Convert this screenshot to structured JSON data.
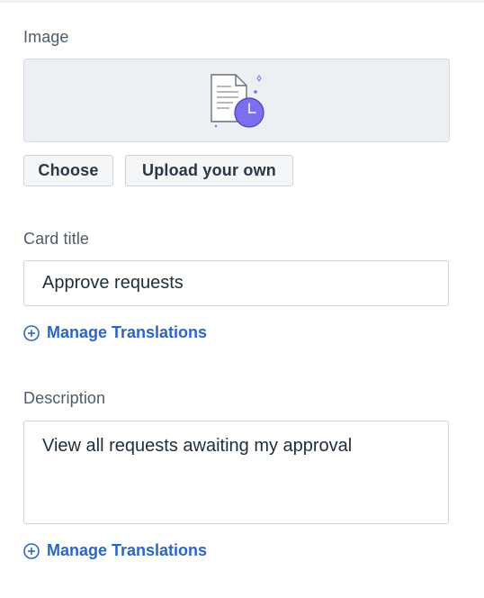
{
  "image_section": {
    "label": "Image",
    "illustration_icon": "document-clock-icon",
    "choose_label": "Choose",
    "upload_label": "Upload your own"
  },
  "card_title_section": {
    "label": "Card title",
    "value": "Approve requests",
    "translations_link": "Manage Translations",
    "translations_icon": "plus-circle-icon"
  },
  "description_section": {
    "label": "Description",
    "value": "View all requests awaiting my approval",
    "translations_link": "Manage Translations",
    "translations_icon": "plus-circle-icon"
  },
  "colors": {
    "accent": "#2c66c4",
    "illustration_accent": "#7b6ff0"
  }
}
